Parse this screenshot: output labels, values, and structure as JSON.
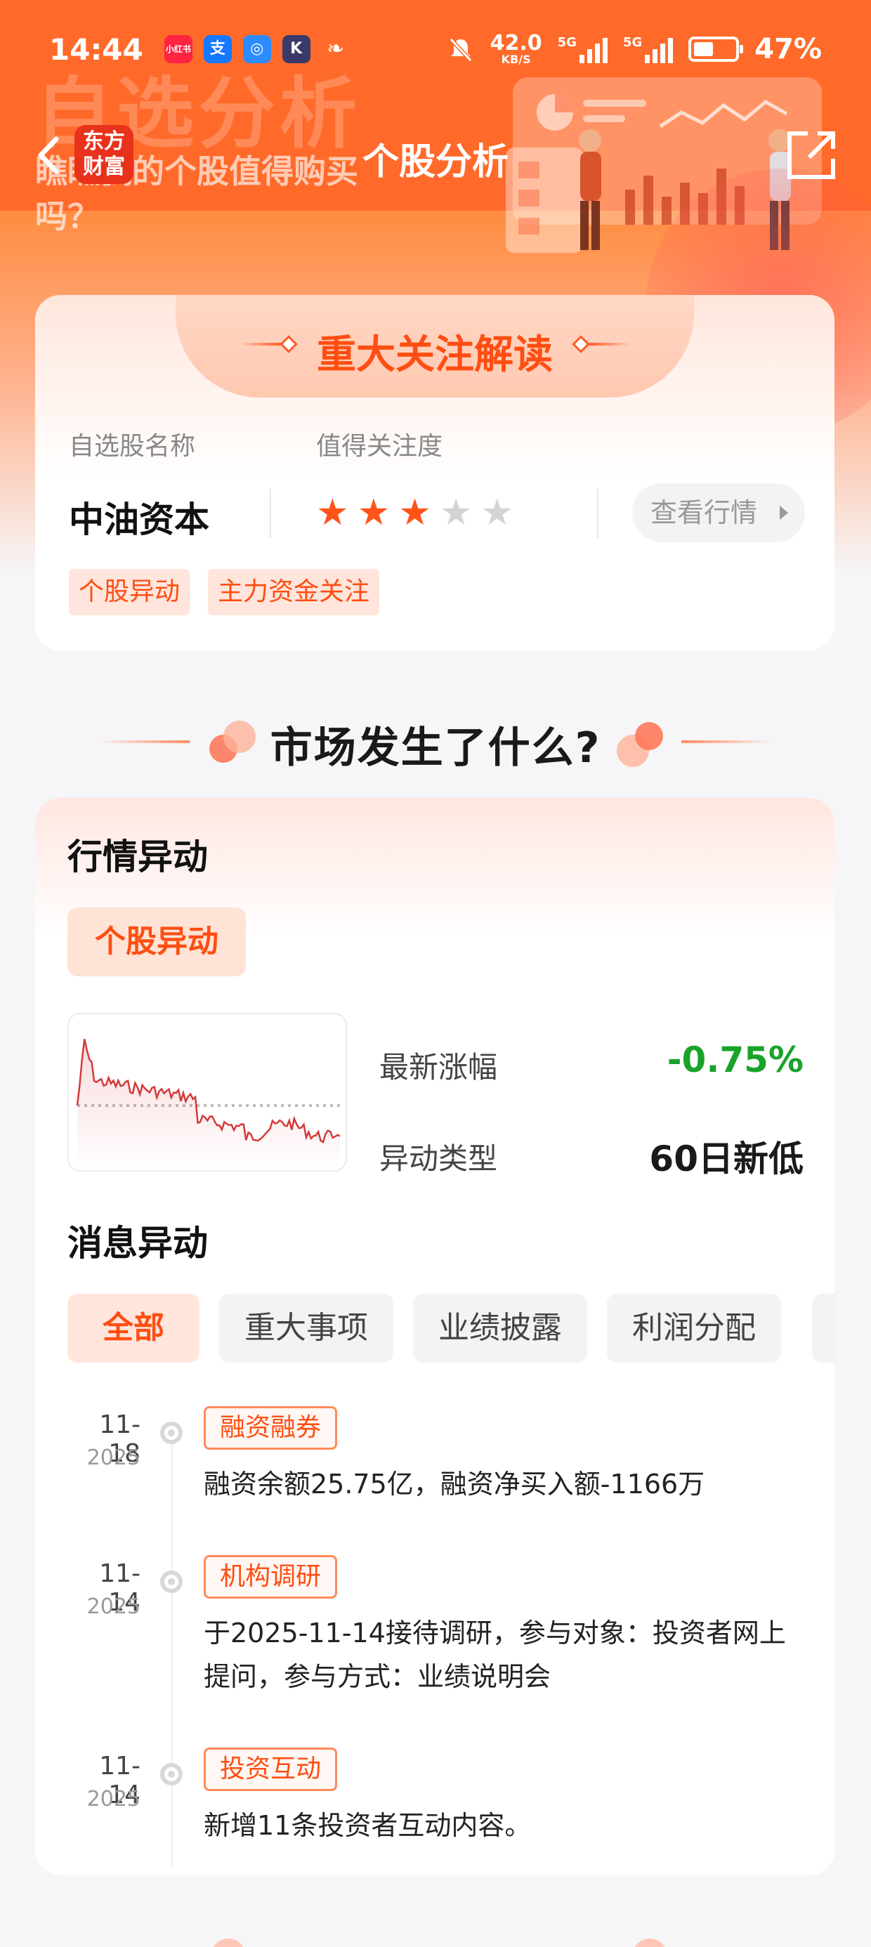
{
  "status_bar": {
    "time": "14:44",
    "apps": [
      {
        "name": "xiaohongshu-icon",
        "label": "小红书",
        "color": "#ff2442"
      },
      {
        "name": "alipay-icon",
        "label": "支",
        "color": "#1677ff"
      },
      {
        "name": "app-ring-icon",
        "label": "◎",
        "color": "#2a8cff"
      },
      {
        "name": "k-app-icon",
        "label": "K",
        "color": "#3a3a6a"
      },
      {
        "name": "bird-app-icon",
        "label": "",
        "color": "transparent"
      }
    ],
    "net_speed_value": "42.0",
    "net_speed_unit": "KB/S",
    "net_label_1": "5G",
    "net_label_2": "5G",
    "battery": "47%",
    "battery_level": 0.47
  },
  "nav": {
    "logo_line1": "东方",
    "logo_line2": "财富",
    "title": "个股分析"
  },
  "hero": {
    "deco_title": "自选分析",
    "deco_subtitle": "瞧瞧我的个股值得购买吗？"
  },
  "focus_card": {
    "title": "重大关注解读",
    "name_label": "自选股名称",
    "attention_label": "值得关注度",
    "stock_name": "中油资本",
    "rating": 3,
    "rating_max": 5,
    "quote_button": "查看行情",
    "tags": [
      "个股异动",
      "主力资金关注"
    ]
  },
  "section": {
    "title": "市场发生了什么?"
  },
  "market_card": {
    "quote_heading": "行情异动",
    "quote_pill": "个股异动",
    "latest_change_label": "最新涨幅",
    "latest_change_value": "-0.75%",
    "anomaly_type_label": "异动类型",
    "anomaly_type_value": "60日新低",
    "news_heading": "消息异动",
    "filters": [
      "全部",
      "重大事项",
      "业绩披露",
      "利润分配"
    ],
    "active_filter": 0,
    "timeline": [
      {
        "date": "11-18",
        "year": "2025",
        "tag": "融资融券",
        "text": "融资余额25.75亿，融资净买入额-1166万"
      },
      {
        "date": "11-14",
        "year": "2025",
        "tag": "机构调研",
        "text": "于2025-11-14接待调研，参与对象：投资者网上提问，参与方式：业绩说明会"
      },
      {
        "date": "11-14",
        "year": "2025",
        "tag": "投资互动",
        "text": "新增11条投资者互动内容。"
      }
    ]
  },
  "colors": {
    "accent": "#ff4e12",
    "down": "#1aa32a",
    "line": "#d23a3a"
  }
}
